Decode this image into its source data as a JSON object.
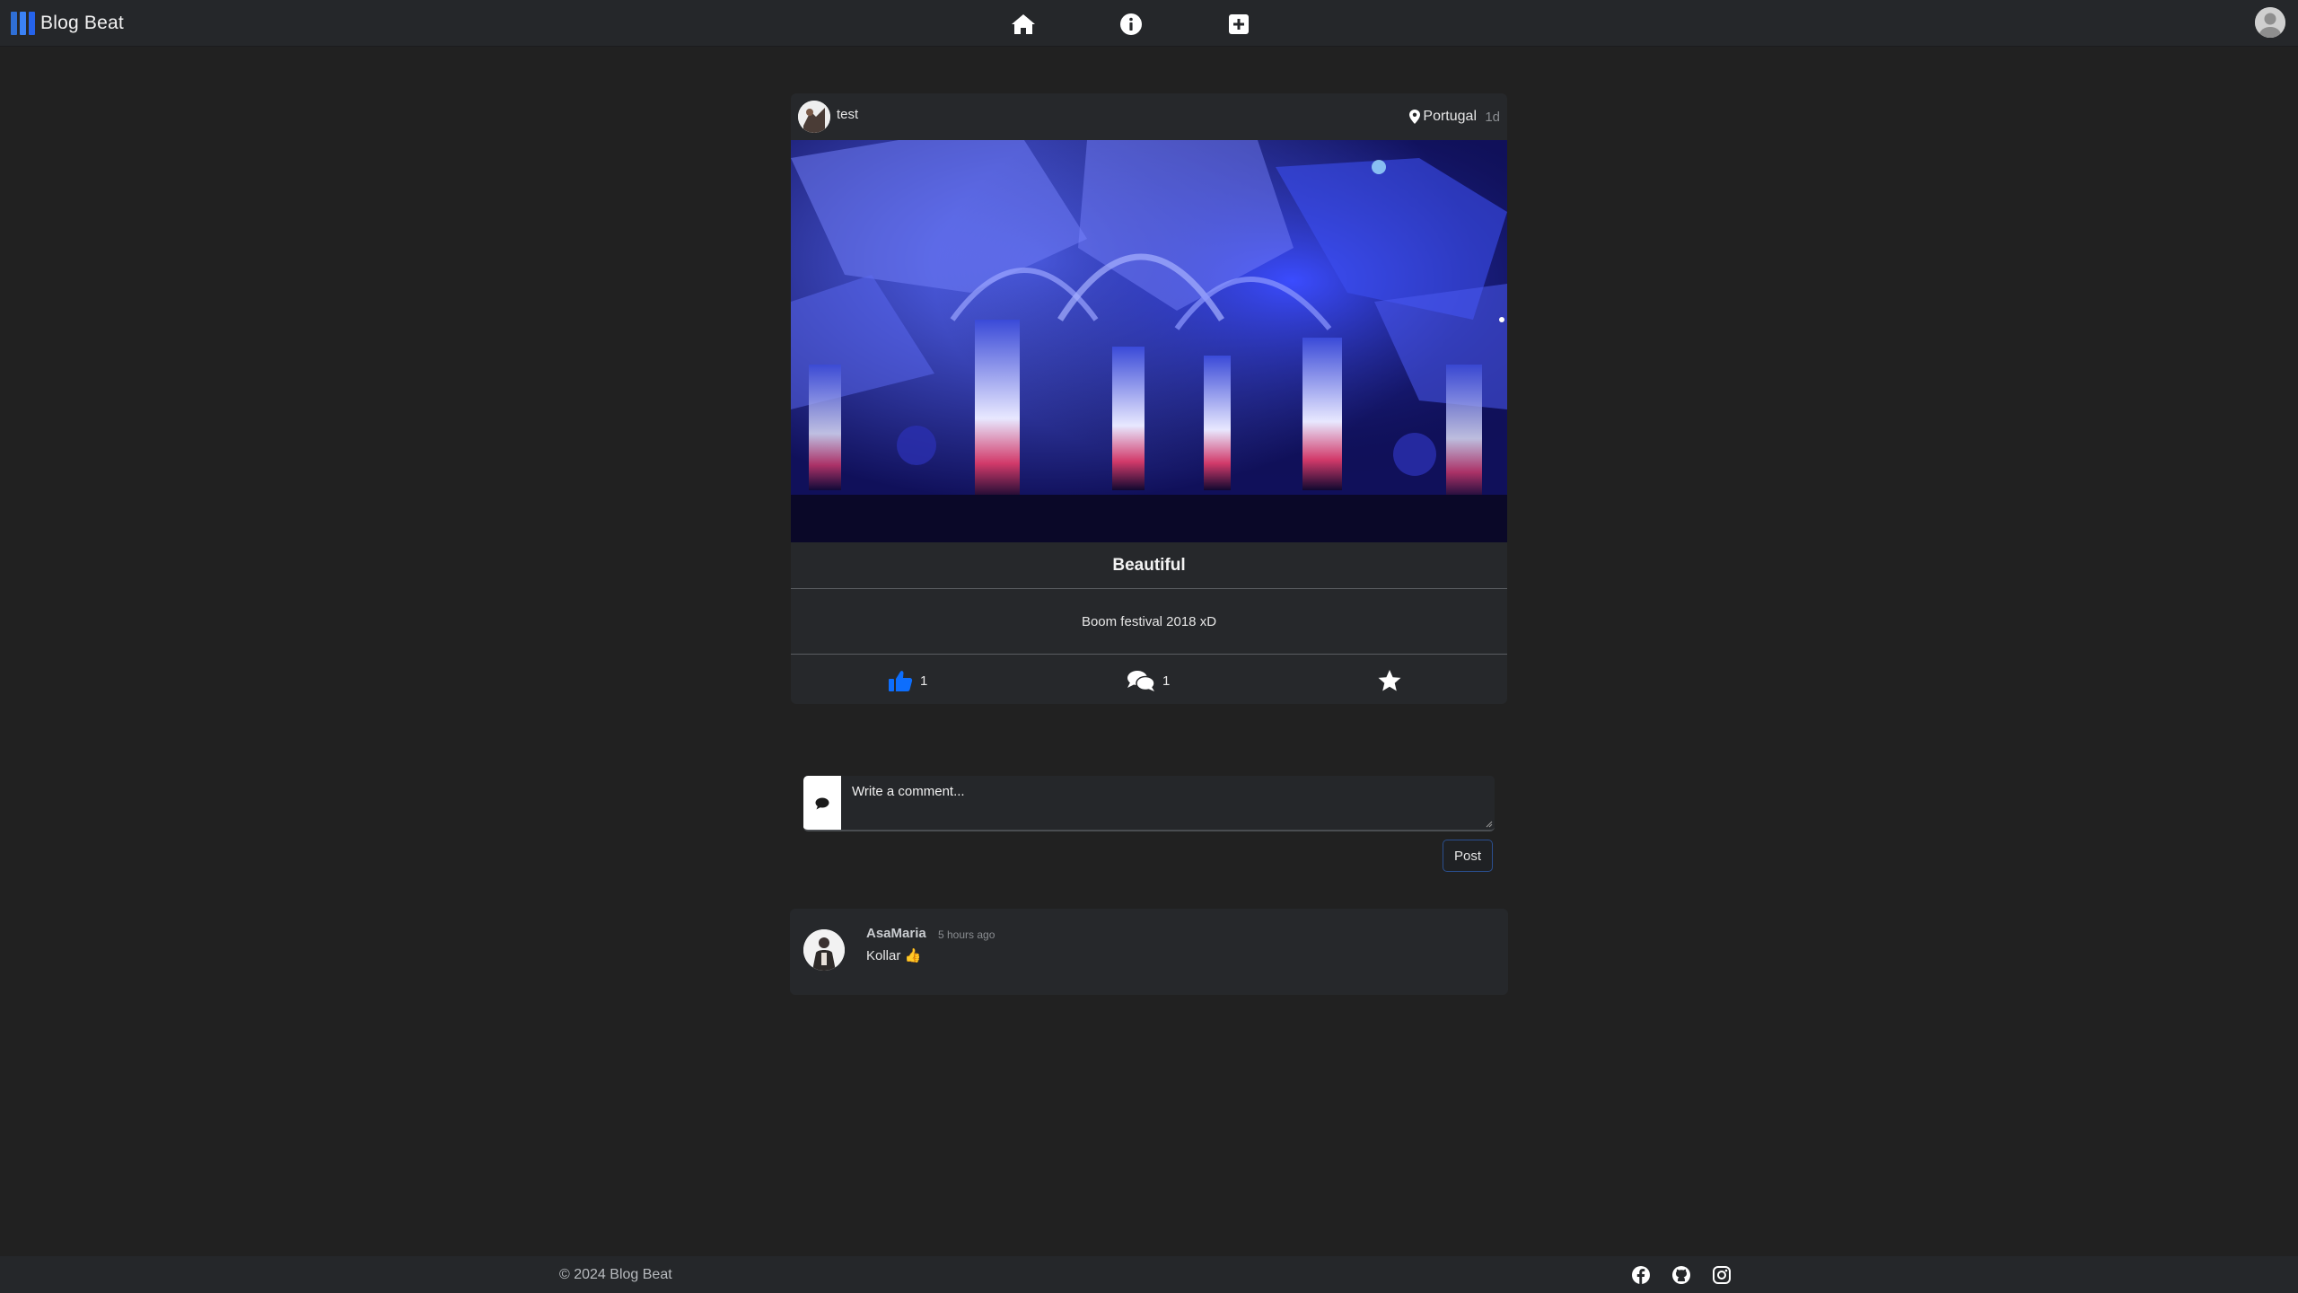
{
  "navbar": {
    "brand": "Blog Beat",
    "icons": [
      "home-icon",
      "info-icon",
      "add-post-icon"
    ],
    "user_icon": "user-avatar-icon"
  },
  "post": {
    "author": "test",
    "location": "Portugal",
    "age": "1d",
    "title": "Beautiful",
    "body": "Boom festival 2018 xD",
    "likes": "1",
    "comments": "1",
    "icons": {
      "like": "thumbs-up-icon",
      "comment": "comments-icon",
      "favorite": "star-icon",
      "location": "location-pin-icon"
    },
    "accent_color": "#0d6efd"
  },
  "comment_form": {
    "placeholder": "Write a comment...",
    "submit_label": "Post"
  },
  "comments": [
    {
      "author": "AsaMaria",
      "time": "5 hours ago",
      "text": "Kollar 👍"
    }
  ],
  "footer": {
    "copyright": "© 2024 Blog Beat",
    "social": [
      "facebook-icon",
      "github-icon",
      "instagram-icon"
    ]
  }
}
